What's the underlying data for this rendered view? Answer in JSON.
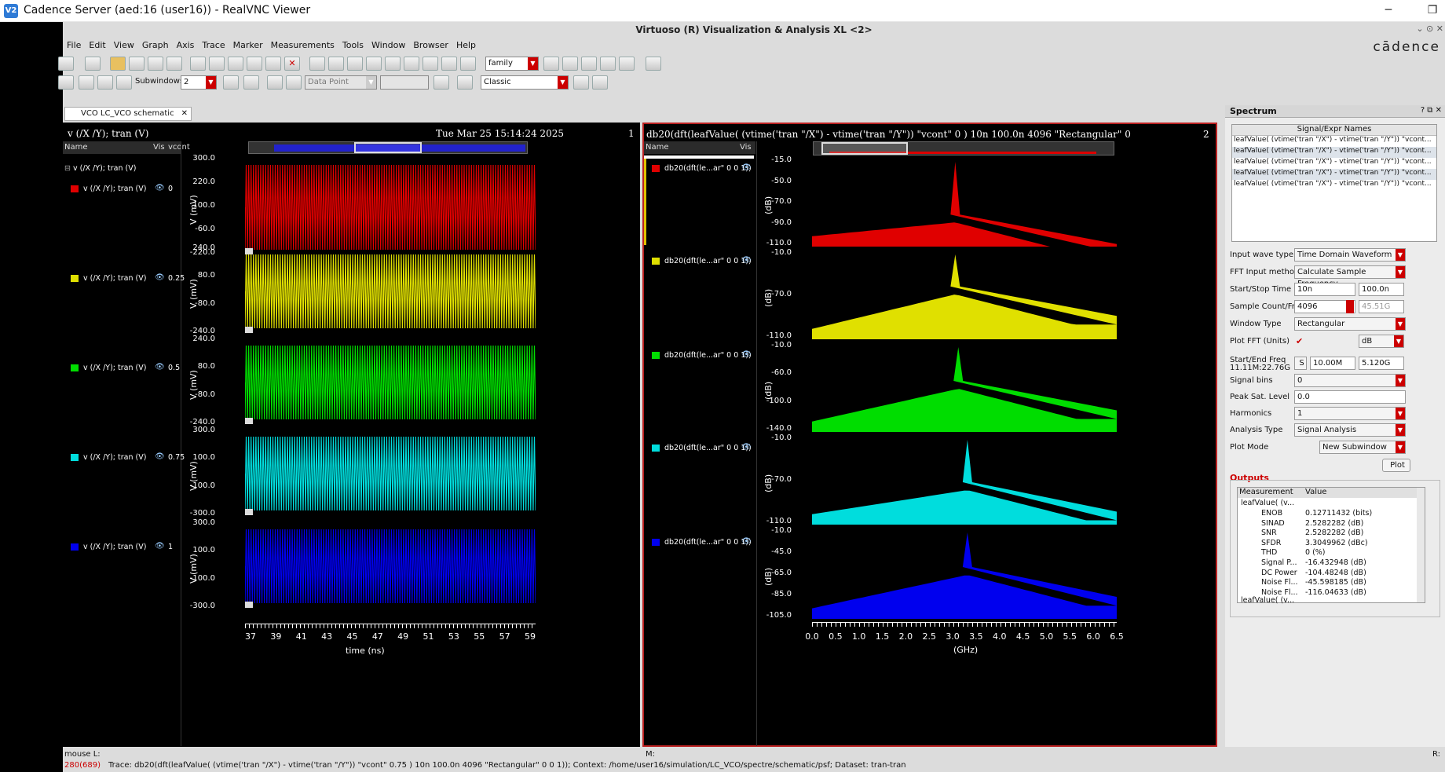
{
  "window": {
    "title": "Cadence Server (aed:16 (user16)) - RealVNC Viewer",
    "app_title": "Virtuoso (R) Visualization & Analysis XL <2>",
    "logo": "cādence"
  },
  "menu": [
    "File",
    "Edit",
    "View",
    "Graph",
    "Axis",
    "Trace",
    "Marker",
    "Measurements",
    "Tools",
    "Window",
    "Browser",
    "Help"
  ],
  "toolbar": {
    "family": "family",
    "subwindows_label": "Subwindows:",
    "subwindows_value": "2",
    "data_point": "Data Point",
    "style": "Classic"
  },
  "tab": {
    "label": "VCO LC_VCO schematic"
  },
  "left": {
    "title": "v (/X /Y); tran (V)",
    "timestamp": "Tue Mar 25 15:14:24 2025",
    "index": "1",
    "legend_header": {
      "name": "Name",
      "vis": "Vis",
      "vcont": "vcont"
    },
    "group": "v (/X /Y); tran (V)",
    "rows": [
      {
        "label": "v (/X /Y); tran (V)",
        "vcont": "0",
        "color": "#e00000"
      },
      {
        "label": "v (/X /Y); tran (V)",
        "vcont": "0.25",
        "color": "#e0e000"
      },
      {
        "label": "v (/X /Y); tran (V)",
        "vcont": "0.5",
        "color": "#00dd00"
      },
      {
        "label": "v (/X /Y); tran (V)",
        "vcont": "0.75",
        "color": "#00dddd"
      },
      {
        "label": "v (/X /Y); tran (V)",
        "vcont": "1",
        "color": "#0000ee"
      }
    ],
    "yunit": "V (mV)",
    "yticks": [
      [
        "300.0",
        "220.0",
        "100.0",
        "-60.0",
        "-220.0"
      ],
      [
        "240.0",
        "80.0",
        "-80.0",
        "-240.0"
      ],
      [
        "240.0",
        "80.0",
        "-80.0",
        "-240.0"
      ],
      [
        "300.0",
        "100.0",
        "-100.0",
        "-300.0"
      ],
      [
        "300.0",
        "100.0",
        "-100.0",
        "-300.0"
      ]
    ],
    "xticks": [
      "37",
      "39",
      "41",
      "43",
      "45",
      "47",
      "49",
      "51",
      "53",
      "55",
      "57",
      "59"
    ],
    "xlabel": "time (ns)"
  },
  "right": {
    "title": "db20(dft(leafValue( (vtime('tran \"/X\") - vtime('tran \"/Y\")) \"vcont\" 0 )  10n 100.0n 4096 \"Rectangular\" 0 0 1))",
    "index": "2",
    "legend_header": {
      "name": "Name",
      "vis": "Vis"
    },
    "rows": [
      {
        "label": "db20(dft(le...ar\" 0 0 1))",
        "color": "#e00000"
      },
      {
        "label": "db20(dft(le...ar\" 0 0 1))",
        "color": "#e0e000"
      },
      {
        "label": "db20(dft(le...ar\" 0 0 1))",
        "color": "#00dd00"
      },
      {
        "label": "db20(dft(le...ar\" 0 0 1))",
        "color": "#00dddd"
      },
      {
        "label": "db20(dft(le...ar\" 0 0 1))",
        "color": "#0000ee"
      }
    ],
    "yunit": "(dB)",
    "yticks": [
      [
        "-15.0",
        "-50.0",
        "-70.0",
        "-90.0",
        "-110.0"
      ],
      [
        "-10.0",
        "-70.0",
        "-110.0"
      ],
      [
        "-10.0",
        "-60.0",
        "-100.0",
        "-140.0"
      ],
      [
        "-10.0",
        "-70.0",
        "-110.0"
      ],
      [
        "-10.0",
        "-45.0",
        "-65.0",
        "-85.0",
        "-105.0"
      ]
    ],
    "xticks": [
      "0.0",
      "0.5",
      "1.0",
      "1.5",
      "2.0",
      "2.5",
      "3.0",
      "3.5",
      "4.0",
      "4.5",
      "5.0",
      "5.5",
      "6.0",
      "6.5"
    ],
    "xlabel": "(GHz)"
  },
  "spectrum": {
    "title": "Spectrum",
    "list_header": "Signal/Expr Names",
    "list": [
      "leafValue( (vtime('tran \"/X\") - vtime('tran \"/Y\")) \"vcont...",
      "leafValue( (vtime('tran \"/X\") - vtime('tran \"/Y\")) \"vcont...",
      "leafValue( (vtime('tran \"/X\") - vtime('tran \"/Y\")) \"vcont...",
      "leafValue( (vtime('tran \"/X\") - vtime('tran \"/Y\")) \"vcont...",
      "leafValue( (vtime('tran \"/X\") - vtime('tran \"/Y\")) \"vcont..."
    ],
    "input_wave_type_label": "Input wave type",
    "input_wave_type": "Time Domain Waveform",
    "fft_method_label": "FFT Input method",
    "fft_method": "Calculate Sample Frequency",
    "startstop_label": "Start/Stop Time",
    "start": "10n",
    "stop": "100.0n",
    "sample_label": "Sample Count/Freq",
    "sample_count": "4096",
    "sample_freq": "45.51G",
    "window_label": "Window Type",
    "window": "Rectangular",
    "plotfft_label": "Plot FFT (Units)",
    "plotfft_units": "dB",
    "startend_label": "Start/End Freq",
    "startend_sub": "11.11M:22.76G",
    "s_btn": "S",
    "start_freq": "10.00M",
    "end_freq": "5.120G",
    "bins_label": "Signal bins",
    "bins": "0",
    "peak_label": "Peak Sat. Level",
    "peak": "0.0",
    "harm_label": "Harmonics",
    "harm": "1",
    "analysis_label": "Analysis Type",
    "analysis": "Signal Analysis",
    "plotmode_label": "Plot Mode",
    "plotmode": "New Subwindow",
    "plot_btn": "Plot",
    "outputs_label": "Outputs",
    "out_header": {
      "m": "Measurement",
      "v": "Value"
    },
    "out_parent": "leafValue( (v...",
    "outputs": [
      [
        "ENOB",
        "0.12711432 (bits)"
      ],
      [
        "SINAD",
        "2.5282282 (dB)"
      ],
      [
        "SNR",
        "2.5282282 (dB)"
      ],
      [
        "SFDR",
        "3.3049962 (dBc)"
      ],
      [
        "THD",
        "0 (%)"
      ],
      [
        "Signal P...",
        "-16.432948 (dB)"
      ],
      [
        "DC Power",
        "-104.48248 (dB)"
      ],
      [
        "Noise Fl...",
        "-45.598185 (dB)"
      ],
      [
        "Noise Fl...",
        "-116.04633 (dB)"
      ]
    ],
    "out_parent2": "leafValue( (v..."
  },
  "status": {
    "mouse": "mouse L:",
    "middle": "M:",
    "right": "R:",
    "count": "280(689)",
    "trace": "Trace: db20(dft(leafValue( (vtime('tran \"/X\") - vtime('tran \"/Y\")) \"vcont\" 0.75 )  10n 100.0n 4096 \"Rectangular\" 0 0 1)); Context: /home/user16/simulation/LC_VCO/spectre/schematic/psf; Dataset: tran-tran"
  }
}
